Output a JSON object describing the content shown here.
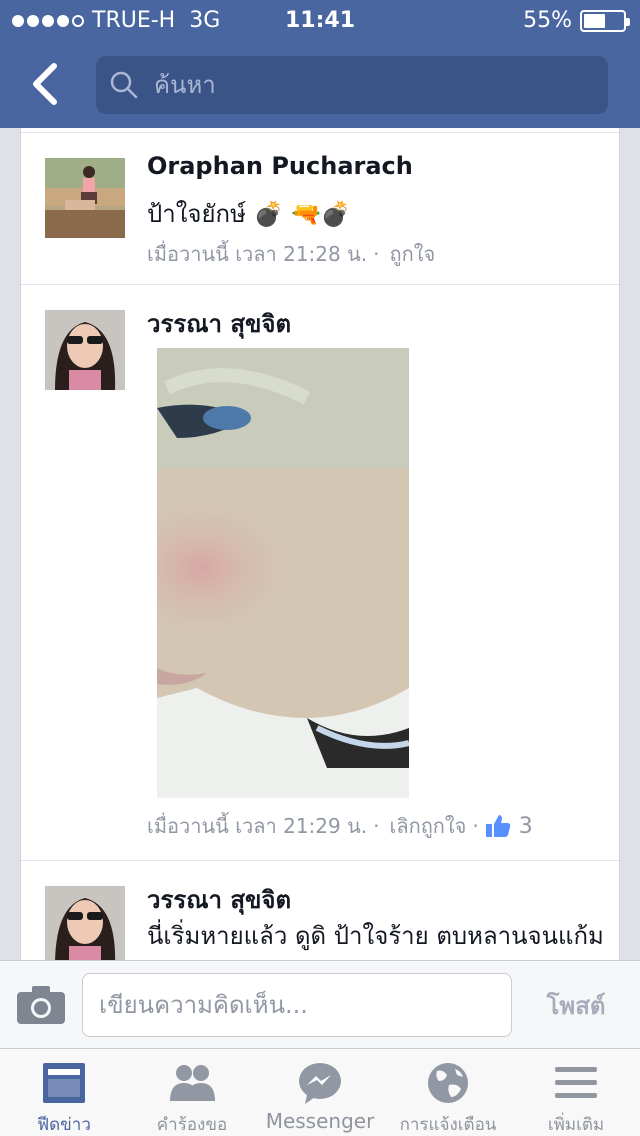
{
  "status_bar": {
    "carrier": "TRUE-H",
    "network": "3G",
    "time": "11:41",
    "battery": "55%",
    "battery_level": 0.55,
    "signal_bars": 4
  },
  "header": {
    "search_placeholder": "ค้นหา"
  },
  "comments": [
    {
      "name": "Oraphan Pucharach",
      "text": "ป้าใจยักษ์ 💣 🔫💣",
      "time": "เมื่อวานนี้ เวลา 21:28 น.",
      "like_action": "ถูกใจ"
    },
    {
      "name": "วรรณา สุขจิต",
      "time": "เมื่อวานนี้ เวลา 21:29 น.",
      "like_action": "เลิกถูกใจ",
      "like_count": "3"
    },
    {
      "name": "วรรณา สุขจิต",
      "text": "นี่เริ่มหายแล้ว ดูดิ ป้าใจร้าย ตบหลานจนแก้ม"
    }
  ],
  "composer": {
    "placeholder": "เขียนความคิดเห็น...",
    "post_label": "โพสต์"
  },
  "tabs": [
    {
      "label": "ฟีดข่าว",
      "icon": "news-feed-icon",
      "active": true
    },
    {
      "label": "คำร้องขอ",
      "icon": "friend-requests-icon"
    },
    {
      "label": "Messenger",
      "icon": "messenger-icon"
    },
    {
      "label": "การแจ้งเตือน",
      "icon": "globe-icon"
    },
    {
      "label": "เพิ่มเติม",
      "icon": "menu-icon"
    }
  ],
  "colors": {
    "brand_blue": "#4a66a0",
    "search_bg": "#3b5488",
    "meta_gray": "#9197a3",
    "like_blue": "#5890ff"
  }
}
